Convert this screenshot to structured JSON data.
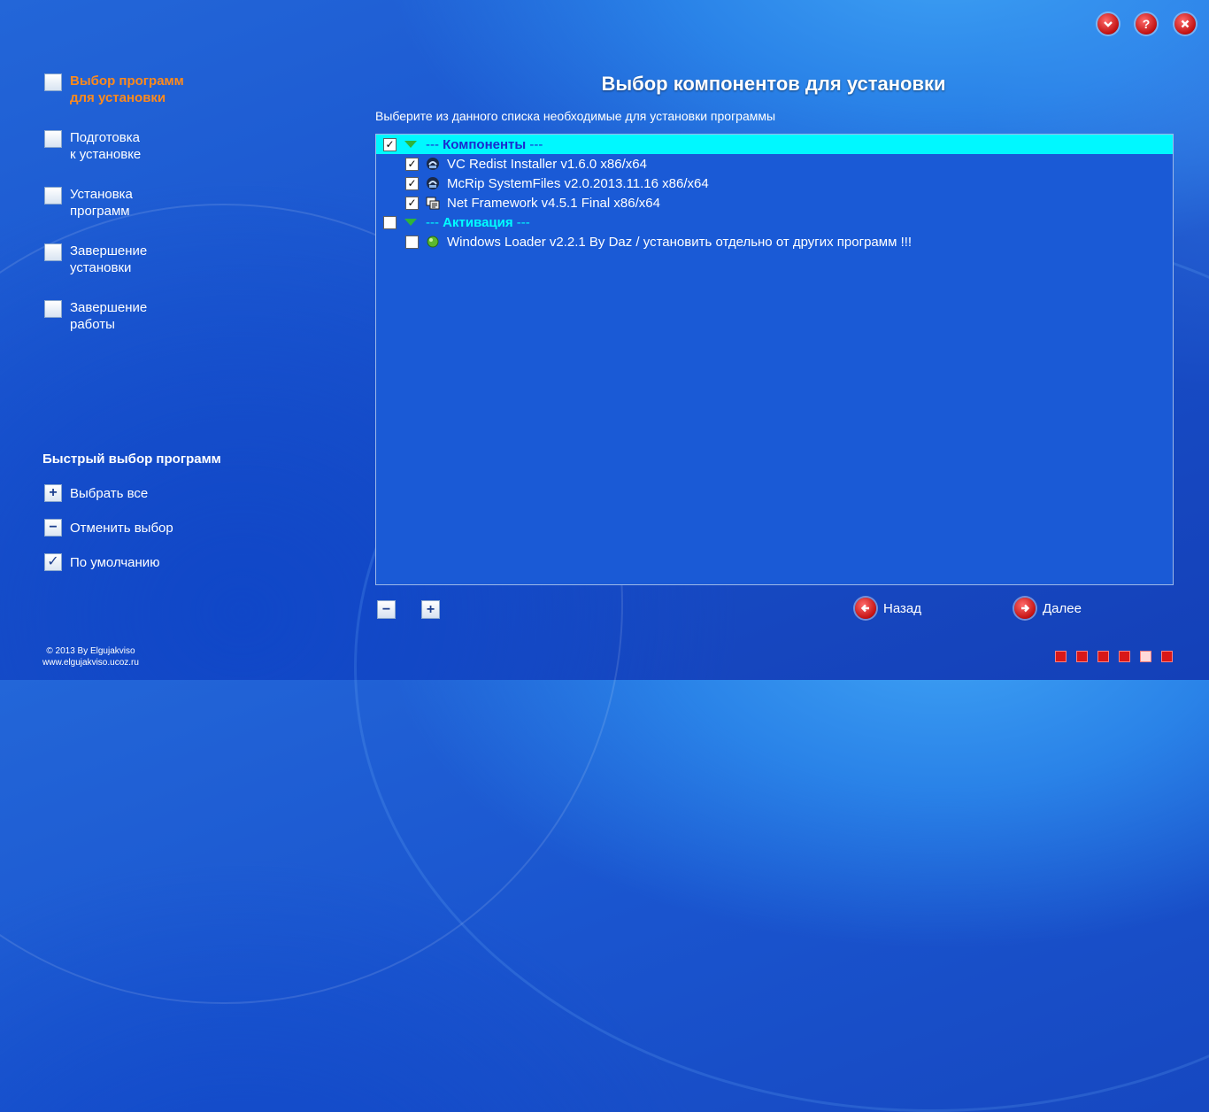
{
  "window": {
    "buttons": [
      {
        "name": "minimize",
        "icon": "chevron-down-icon"
      },
      {
        "name": "help",
        "label": "?",
        "icon": "help-icon"
      },
      {
        "name": "close",
        "icon": "close-icon"
      }
    ]
  },
  "sidebar": {
    "steps": [
      {
        "label": "Выбор программ\nдля установки",
        "active": true
      },
      {
        "label": "Подготовка\nк установке",
        "active": false
      },
      {
        "label": "Установка\nпрограмм",
        "active": false
      },
      {
        "label": "Завершение\nустановки",
        "active": false
      },
      {
        "label": "Завершение\nработы",
        "active": false
      }
    ],
    "quick_title": "Быстрый выбор программ",
    "quick": [
      {
        "label": "Выбрать все",
        "icon": "plus-icon",
        "glyph": "+"
      },
      {
        "label": "Отменить выбор",
        "icon": "minus-icon",
        "glyph": "−"
      },
      {
        "label": "По умолчанию",
        "icon": "checkmark-icon",
        "glyph": "✓"
      }
    ],
    "footer_line1": "© 2013 By Elgujakviso",
    "footer_line2": "www.elgujakviso.ucoz.ru"
  },
  "main": {
    "title": "Выбор компонентов для установки",
    "subtitle": "Выберите из данного списка необходимые для установки программы",
    "groups": [
      {
        "label": "Компоненты",
        "prefix": "--- ",
        "suffix": " ---",
        "checked": true,
        "items": [
          {
            "label": "VC Redist Installer v1.6.0 x86/x64",
            "checked": true,
            "icon": "installer-icon"
          },
          {
            "label": "McRip SystemFiles v2.0.2013.11.16 x86/x64",
            "checked": true,
            "icon": "installer-icon"
          },
          {
            "label": "Net Framework v4.5.1 Final x86/x64",
            "checked": true,
            "icon": "framework-icon"
          }
        ]
      },
      {
        "label": "Активация",
        "prefix": "--- ",
        "suffix": " ---",
        "checked": false,
        "items": [
          {
            "label": "Windows Loader v2.2.1 By Daz / установить отдельно от других программ !!!",
            "checked": false,
            "icon": "globe-icon"
          }
        ]
      }
    ],
    "collapse_glyph": "−",
    "expand_glyph": "+",
    "back_label": "Назад",
    "next_label": "Далее"
  },
  "progress": {
    "total": 6,
    "current": 5
  },
  "colors": {
    "accent_orange": "#ff8a1c",
    "selected_row": "#00f8ff",
    "tree_bg": "#1a5ad6"
  }
}
